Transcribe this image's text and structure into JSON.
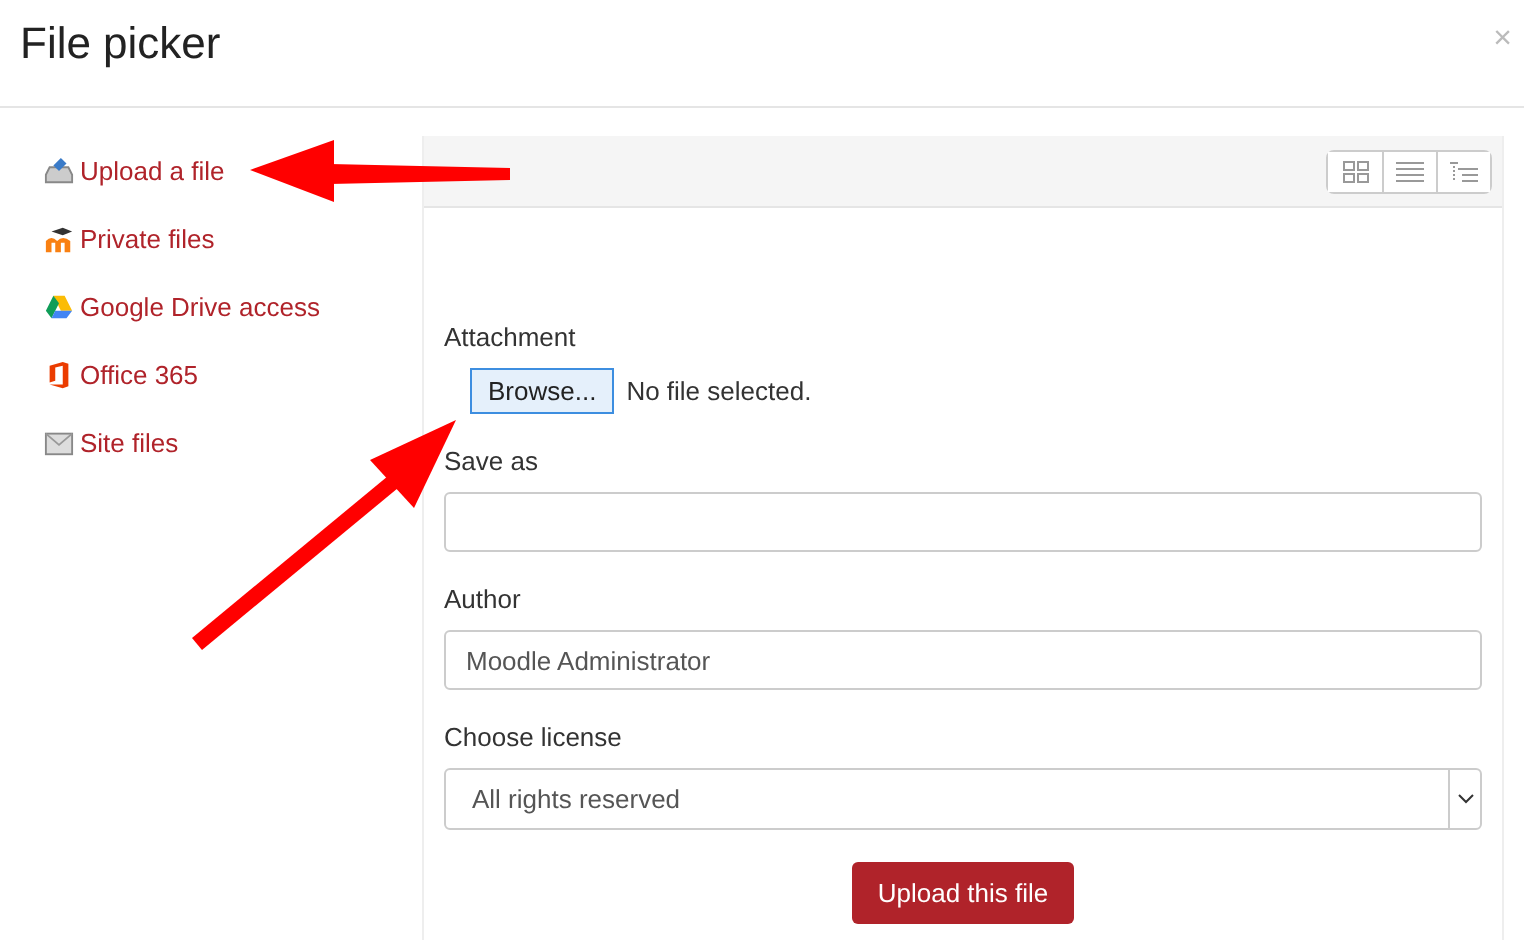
{
  "dialog": {
    "title": "File picker",
    "close": "×"
  },
  "sidebar": {
    "items": [
      {
        "label": "Upload a file",
        "kind": "upload"
      },
      {
        "label": "Private files",
        "kind": "private"
      },
      {
        "label": "Google Drive access",
        "kind": "drive"
      },
      {
        "label": "Office 365",
        "kind": "office"
      },
      {
        "label": "Site files",
        "kind": "site"
      }
    ]
  },
  "toolbar": {
    "views": [
      {
        "kind": "icons"
      },
      {
        "kind": "list"
      },
      {
        "kind": "tree"
      }
    ]
  },
  "form": {
    "attachment": {
      "label": "Attachment",
      "button": "Browse...",
      "status": "No file selected."
    },
    "save_as": {
      "label": "Save as"
    },
    "author": {
      "label": "Author",
      "value": "Moodle Administrator"
    },
    "license": {
      "label": "Choose license",
      "value": "All rights reserved"
    },
    "submit": "Upload this file"
  },
  "annotations": [
    {
      "kind": "arrow"
    },
    {
      "kind": "arrow"
    }
  ]
}
